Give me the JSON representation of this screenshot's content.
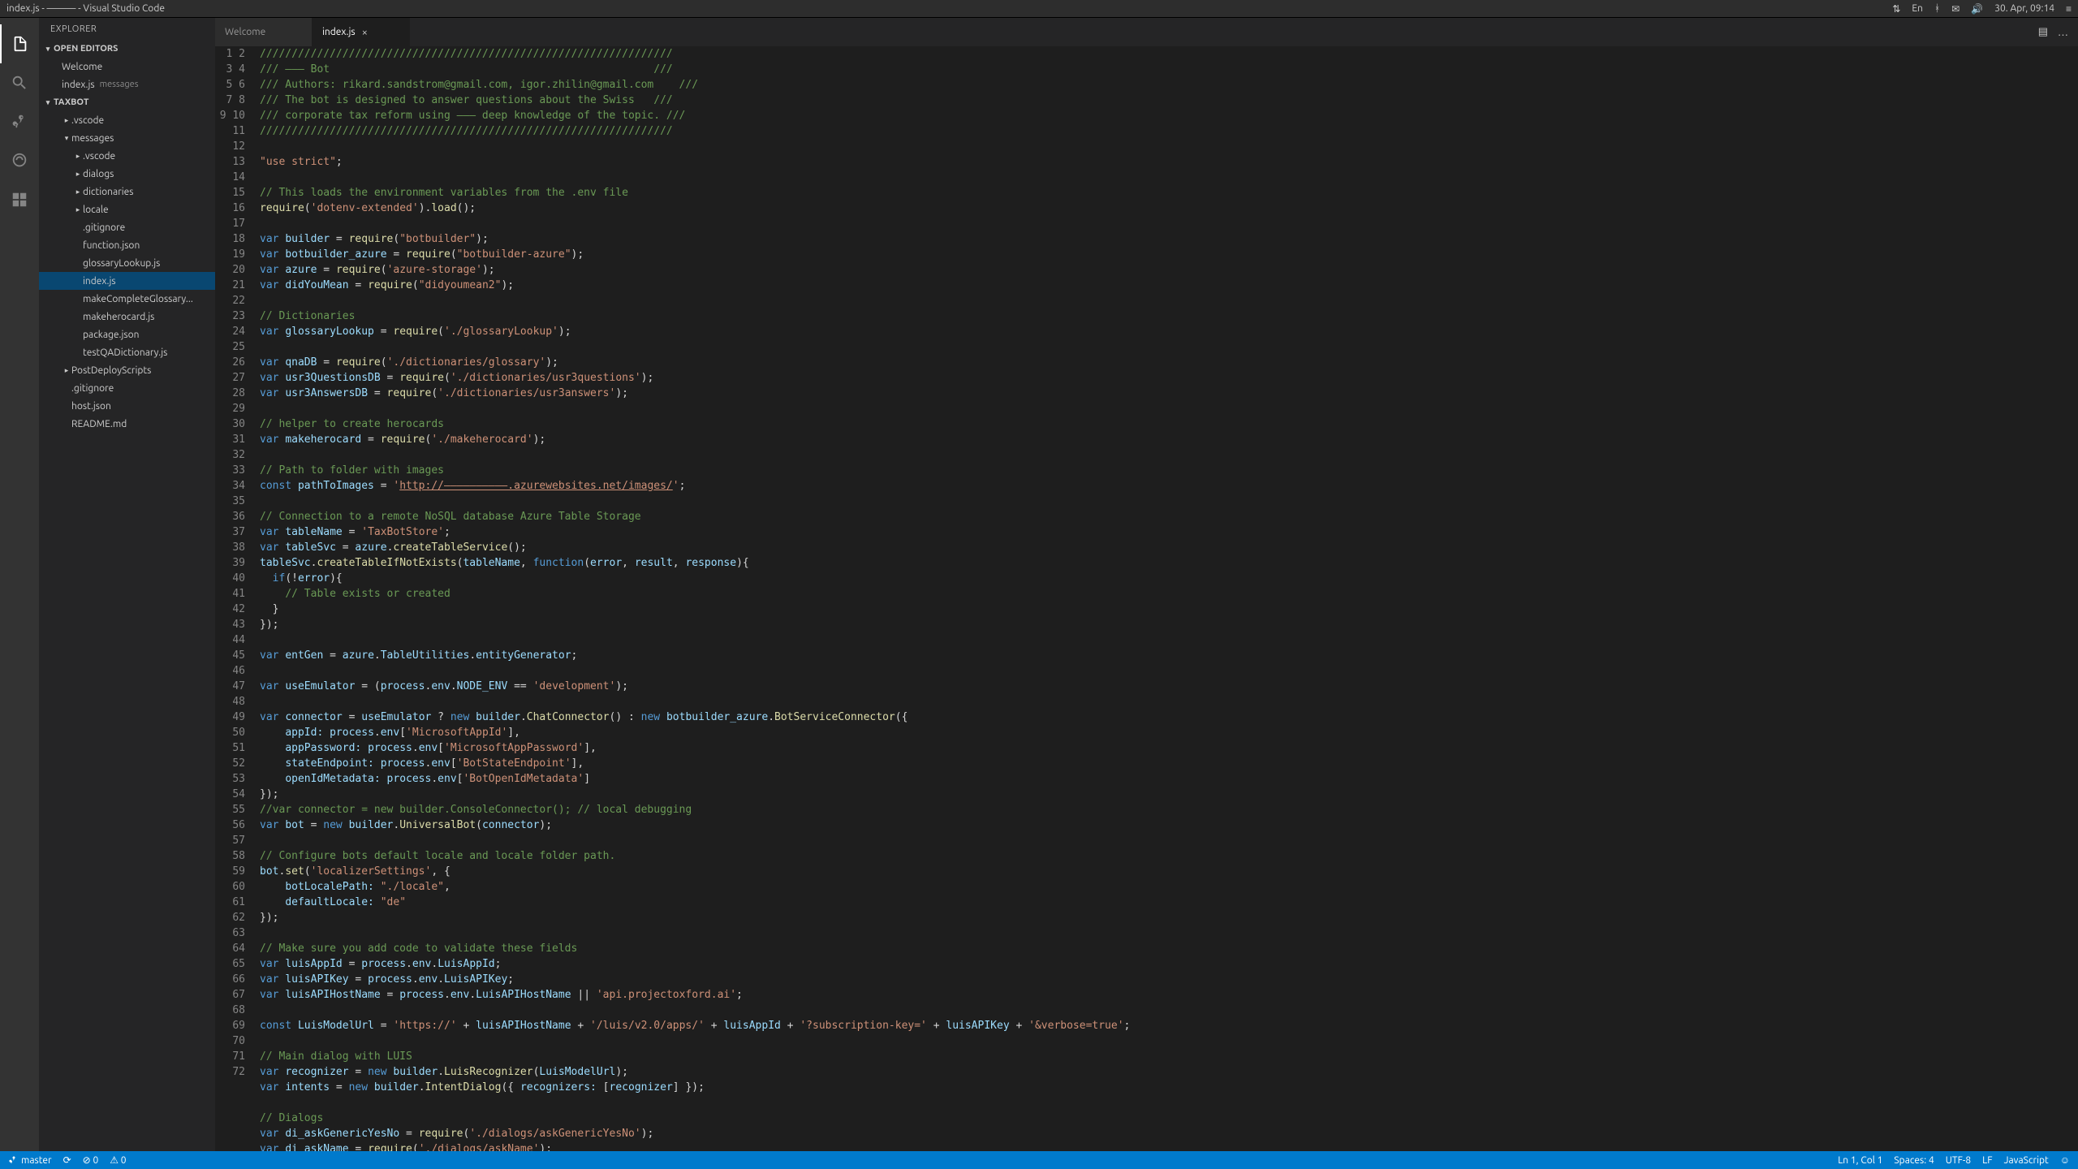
{
  "window": {
    "title": "index.js - ——— - Visual Studio Code"
  },
  "menubar_right": {
    "sync": "⇅",
    "lang": "En",
    "bt": "ᚼ",
    "mail": "✉",
    "vol": "🔊",
    "date": "30. Apr, 09:14",
    "menu": "≡"
  },
  "sidebar": {
    "title": "EXPLORER",
    "open_editors": {
      "label": "OPEN EDITORS",
      "items": [
        {
          "name": "Welcome",
          "path": ""
        },
        {
          "name": "index.js",
          "path": "messages"
        }
      ]
    },
    "workspace": {
      "label": "TAXBOT",
      "tree": [
        {
          "depth": 2,
          "chev": "▸",
          "name": ".vscode"
        },
        {
          "depth": 2,
          "chev": "▾",
          "name": "messages",
          "sel": false
        },
        {
          "depth": 3,
          "chev": "▸",
          "name": ".vscode"
        },
        {
          "depth": 3,
          "chev": "▸",
          "name": "dialogs"
        },
        {
          "depth": 3,
          "chev": "▸",
          "name": "dictionaries"
        },
        {
          "depth": 3,
          "chev": "▸",
          "name": "locale"
        },
        {
          "depth": 3,
          "chev": "",
          "name": ".gitignore"
        },
        {
          "depth": 3,
          "chev": "",
          "name": "function.json"
        },
        {
          "depth": 3,
          "chev": "",
          "name": "glossaryLookup.js"
        },
        {
          "depth": 3,
          "chev": "",
          "name": "index.js",
          "sel": true
        },
        {
          "depth": 3,
          "chev": "",
          "name": "makeCompleteGlossary..."
        },
        {
          "depth": 3,
          "chev": "",
          "name": "makeherocard.js"
        },
        {
          "depth": 3,
          "chev": "",
          "name": "package.json"
        },
        {
          "depth": 3,
          "chev": "",
          "name": "testQADictionary.js"
        },
        {
          "depth": 2,
          "chev": "▸",
          "name": "PostDeployScripts"
        },
        {
          "depth": 2,
          "chev": "",
          "name": ".gitignore"
        },
        {
          "depth": 2,
          "chev": "",
          "name": "host.json"
        },
        {
          "depth": 2,
          "chev": "",
          "name": "README.md"
        }
      ]
    }
  },
  "tabs": [
    {
      "label": "Welcome",
      "active": false
    },
    {
      "label": "index.js",
      "active": true
    }
  ],
  "tab_actions": {
    "split": "▤",
    "more": "…"
  },
  "code_lines": [
    {
      "n": 1,
      "html": "<span class='c-comment'>/////////////////////////////////////////////////////////////////</span>"
    },
    {
      "n": 2,
      "html": "<span class='c-comment'>/// ——— Bot                                                   ///</span>"
    },
    {
      "n": 3,
      "html": "<span class='c-comment'>/// Authors: rikard.sandstrom@gmail.com, igor.zhilin@gmail.com    ///</span>"
    },
    {
      "n": 4,
      "html": "<span class='c-comment'>/// The bot is designed to answer questions about the Swiss   ///</span>"
    },
    {
      "n": 5,
      "html": "<span class='c-comment'>/// corporate tax reform using ——— deep knowledge of the topic. ///</span>"
    },
    {
      "n": 6,
      "html": "<span class='c-comment'>/////////////////////////////////////////////////////////////////</span>"
    },
    {
      "n": 7,
      "html": ""
    },
    {
      "n": 8,
      "html": "<span class='c-str'>\"use strict\"</span>;"
    },
    {
      "n": 9,
      "html": ""
    },
    {
      "n": 10,
      "html": "<span class='c-comment'>// This loads the environment variables from the .env file</span>"
    },
    {
      "n": 11,
      "html": "<span class='c-fn'>require</span>(<span class='c-str'>'dotenv-extended'</span>).<span class='c-fn'>load</span>();"
    },
    {
      "n": 12,
      "html": ""
    },
    {
      "n": 13,
      "html": "<span class='c-key'>var</span> <span class='c-var'>builder</span> = <span class='c-fn'>require</span>(<span class='c-str'>\"botbuilder\"</span>);"
    },
    {
      "n": 14,
      "html": "<span class='c-key'>var</span> <span class='c-var'>botbuilder_azure</span> = <span class='c-fn'>require</span>(<span class='c-str'>\"botbuilder-azure\"</span>);"
    },
    {
      "n": 15,
      "html": "<span class='c-key'>var</span> <span class='c-var'>azure</span> = <span class='c-fn'>require</span>(<span class='c-str'>'azure-storage'</span>);"
    },
    {
      "n": 16,
      "html": "<span class='c-key'>var</span> <span class='c-var'>didYouMean</span> = <span class='c-fn'>require</span>(<span class='c-str'>\"didyoumean2\"</span>);"
    },
    {
      "n": 17,
      "html": ""
    },
    {
      "n": 18,
      "html": "<span class='c-comment'>// Dictionaries</span>"
    },
    {
      "n": 19,
      "html": "<span class='c-key'>var</span> <span class='c-var'>glossaryLookup</span> = <span class='c-fn'>require</span>(<span class='c-str'>'./glossaryLookup'</span>);"
    },
    {
      "n": 20,
      "html": ""
    },
    {
      "n": 21,
      "html": "<span class='c-key'>var</span> <span class='c-var'>qnaDB</span> = <span class='c-fn'>require</span>(<span class='c-str'>'./dictionaries/glossary'</span>);"
    },
    {
      "n": 22,
      "html": "<span class='c-key'>var</span> <span class='c-var'>usr3QuestionsDB</span> = <span class='c-fn'>require</span>(<span class='c-str'>'./dictionaries/usr3questions'</span>);"
    },
    {
      "n": 23,
      "html": "<span class='c-key'>var</span> <span class='c-var'>usr3AnswersDB</span> = <span class='c-fn'>require</span>(<span class='c-str'>'./dictionaries/usr3answers'</span>);"
    },
    {
      "n": 24,
      "html": ""
    },
    {
      "n": 25,
      "html": "<span class='c-comment'>// helper to create herocards</span>"
    },
    {
      "n": 26,
      "html": "<span class='c-key'>var</span> <span class='c-var'>makeherocard</span> = <span class='c-fn'>require</span>(<span class='c-str'>'./makeherocard'</span>);"
    },
    {
      "n": 27,
      "html": ""
    },
    {
      "n": 28,
      "html": "<span class='c-comment'>// Path to folder with images</span>"
    },
    {
      "n": 29,
      "html": "<span class='c-key'>const</span> <span class='c-var'>pathToImages</span> = <span class='c-str'>'<span class='c-strlink'>http://——————————.azurewebsites.net/images/</span>'</span>;"
    },
    {
      "n": 30,
      "html": ""
    },
    {
      "n": 31,
      "html": "<span class='c-comment'>// Connection to a remote NoSQL database Azure Table Storage</span>"
    },
    {
      "n": 32,
      "html": "<span class='c-key'>var</span> <span class='c-var'>tableName</span> = <span class='c-str'>'TaxBotStore'</span>;"
    },
    {
      "n": 33,
      "html": "<span class='c-key'>var</span> <span class='c-var'>tableSvc</span> = <span class='c-var'>azure</span>.<span class='c-fn'>createTableService</span>();"
    },
    {
      "n": 34,
      "html": "<span class='c-var'>tableSvc</span>.<span class='c-fn'>createTableIfNotExists</span>(<span class='c-var'>tableName</span>, <span class='c-key'>function</span>(<span class='c-var'>error</span>, <span class='c-var'>result</span>, <span class='c-var'>response</span>){"
    },
    {
      "n": 35,
      "html": "  <span class='c-key'>if</span>(!<span class='c-var'>error</span>){"
    },
    {
      "n": 36,
      "html": "    <span class='c-comment'>// Table exists or created</span>"
    },
    {
      "n": 37,
      "html": "  }"
    },
    {
      "n": 38,
      "html": "});"
    },
    {
      "n": 39,
      "html": ""
    },
    {
      "n": 40,
      "html": "<span class='c-key'>var</span> <span class='c-var'>entGen</span> = <span class='c-var'>azure</span>.<span class='c-var'>TableUtilities</span>.<span class='c-var'>entityGenerator</span>;"
    },
    {
      "n": 41,
      "html": ""
    },
    {
      "n": 42,
      "html": "<span class='c-key'>var</span> <span class='c-var'>useEmulator</span> = (<span class='c-var'>process</span>.<span class='c-var'>env</span>.<span class='c-var'>NODE_ENV</span> == <span class='c-str'>'development'</span>);"
    },
    {
      "n": 43,
      "html": ""
    },
    {
      "n": 44,
      "html": "<span class='c-key'>var</span> <span class='c-var'>connector</span> = <span class='c-var'>useEmulator</span> ? <span class='c-key'>new</span> <span class='c-var'>builder</span>.<span class='c-fn'>ChatConnector</span>() : <span class='c-key'>new</span> <span class='c-var'>botbuilder_azure</span>.<span class='c-fn'>BotServiceConnector</span>({"
    },
    {
      "n": 45,
      "html": "    <span class='c-var'>appId:</span> <span class='c-var'>process</span>.<span class='c-var'>env</span>[<span class='c-str'>'MicrosoftAppId'</span>],"
    },
    {
      "n": 46,
      "html": "    <span class='c-var'>appPassword:</span> <span class='c-var'>process</span>.<span class='c-var'>env</span>[<span class='c-str'>'MicrosoftAppPassword'</span>],"
    },
    {
      "n": 47,
      "html": "    <span class='c-var'>stateEndpoint:</span> <span class='c-var'>process</span>.<span class='c-var'>env</span>[<span class='c-str'>'BotStateEndpoint'</span>],"
    },
    {
      "n": 48,
      "html": "    <span class='c-var'>openIdMetadata:</span> <span class='c-var'>process</span>.<span class='c-var'>env</span>[<span class='c-str'>'BotOpenIdMetadata'</span>]"
    },
    {
      "n": 49,
      "html": "});"
    },
    {
      "n": 50,
      "html": "<span class='c-comment'>//var connector = new builder.ConsoleConnector(); // local debugging</span>"
    },
    {
      "n": 51,
      "html": "<span class='c-key'>var</span> <span class='c-var'>bot</span> = <span class='c-key'>new</span> <span class='c-var'>builder</span>.<span class='c-fn'>UniversalBot</span>(<span class='c-var'>connector</span>);"
    },
    {
      "n": 52,
      "html": ""
    },
    {
      "n": 53,
      "html": "<span class='c-comment'>// Configure bots default locale and locale folder path.</span>"
    },
    {
      "n": 54,
      "html": "<span class='c-var'>bot</span>.<span class='c-fn'>set</span>(<span class='c-str'>'localizerSettings'</span>, {"
    },
    {
      "n": 55,
      "html": "    <span class='c-var'>botLocalePath:</span> <span class='c-str'>\"./locale\"</span>,"
    },
    {
      "n": 56,
      "html": "    <span class='c-var'>defaultLocale:</span> <span class='c-str'>\"de\"</span>"
    },
    {
      "n": 57,
      "html": "});"
    },
    {
      "n": 58,
      "html": ""
    },
    {
      "n": 59,
      "html": "<span class='c-comment'>// Make sure you add code to validate these fields</span>"
    },
    {
      "n": 60,
      "html": "<span class='c-key'>var</span> <span class='c-var'>luisAppId</span> = <span class='c-var'>process</span>.<span class='c-var'>env</span>.<span class='c-var'>LuisAppId</span>;"
    },
    {
      "n": 61,
      "html": "<span class='c-key'>var</span> <span class='c-var'>luisAPIKey</span> = <span class='c-var'>process</span>.<span class='c-var'>env</span>.<span class='c-var'>LuisAPIKey</span>;"
    },
    {
      "n": 62,
      "html": "<span class='c-key'>var</span> <span class='c-var'>luisAPIHostName</span> = <span class='c-var'>process</span>.<span class='c-var'>env</span>.<span class='c-var'>LuisAPIHostName</span> || <span class='c-str'>'api.projectoxford.ai'</span>;"
    },
    {
      "n": 63,
      "html": ""
    },
    {
      "n": 64,
      "html": "<span class='c-key'>const</span> <span class='c-var'>LuisModelUrl</span> = <span class='c-str'>'https://'</span> + <span class='c-var'>luisAPIHostName</span> + <span class='c-str'>'/luis/v2.0/apps/'</span> + <span class='c-var'>luisAppId</span> + <span class='c-str'>'?subscription-key='</span> + <span class='c-var'>luisAPIKey</span> + <span class='c-str'>'&verbose=true'</span>;"
    },
    {
      "n": 65,
      "html": ""
    },
    {
      "n": 66,
      "html": "<span class='c-comment'>// Main dialog with LUIS</span>"
    },
    {
      "n": 67,
      "html": "<span class='c-key'>var</span> <span class='c-var'>recognizer</span> = <span class='c-key'>new</span> <span class='c-var'>builder</span>.<span class='c-fn'>LuisRecognizer</span>(<span class='c-var'>LuisModelUrl</span>);"
    },
    {
      "n": 68,
      "html": "<span class='c-key'>var</span> <span class='c-var'>intents</span> = <span class='c-key'>new</span> <span class='c-var'>builder</span>.<span class='c-fn'>IntentDialog</span>({ <span class='c-var'>recognizers:</span> [<span class='c-var'>recognizer</span>] });"
    },
    {
      "n": 69,
      "html": ""
    },
    {
      "n": 70,
      "html": "<span class='c-comment'>// Dialogs</span>"
    },
    {
      "n": 71,
      "html": "<span class='c-key'>var</span> <span class='c-var'>di_askGenericYesNo</span> = <span class='c-fn'>require</span>(<span class='c-str'>'./dialogs/askGenericYesNo'</span>);"
    },
    {
      "n": 72,
      "html": "<span class='c-key'>var</span> <span class='c-var'>di_askName</span> = <span class='c-fn'>require</span>(<span class='c-str'>'./dialogs/askName'</span>);"
    }
  ],
  "statusbar": {
    "branch": "master",
    "sync": "⟳",
    "errors": "⊘ 0",
    "warnings": "⚠ 0",
    "pos": "Ln 1, Col 1",
    "spaces": "Spaces: 4",
    "encoding": "UTF-8",
    "eol": "LF",
    "lang": "JavaScript",
    "feedback": "☺"
  }
}
